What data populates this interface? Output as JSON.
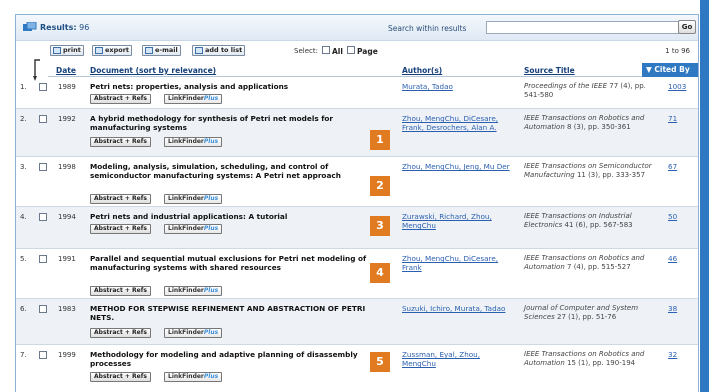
{
  "header": {
    "results_label": "Results:",
    "results_count": "96",
    "search_label": "Search within results",
    "search_value": "",
    "go_label": "Go"
  },
  "toolbar": {
    "print_label": "print",
    "export_label": "export",
    "email_label": "e-mail",
    "addlist_label": "add to list",
    "select_label": "Select:",
    "all_label": "All",
    "page_label": "Page",
    "range_text": "1 to 96"
  },
  "columns": {
    "date": "Date",
    "document": "Document (sort by relevance)",
    "author": "Author(s)",
    "source": "Source Title",
    "cited": "▼ Cited By"
  },
  "row_buttons": {
    "abstract": "Abstract + Refs",
    "linkfinder": "LinkFinder",
    "linkfinder_plus": "Plus"
  },
  "rows": [
    {
      "num": "1.",
      "year": "1989",
      "title": "Petri nets: properties, analysis and applications",
      "authors": "Murata, Tadao",
      "source_journal": "Proceedings of the IEEE",
      "source_detail": "77 (4), pp. 541-580",
      "cited": "1003"
    },
    {
      "num": "2.",
      "year": "1992",
      "title": "A hybrid methodology for synthesis of Petri net models for manufacturing systems",
      "authors": "Zhou, MengChu, DiCesare, Frank, Desrochers, Alan A.",
      "source_journal": "IEEE Transactions on Robotics and Automation",
      "source_detail": "8 (3), pp. 350-361",
      "cited": "71"
    },
    {
      "num": "3.",
      "year": "1998",
      "title": "Modeling, analysis, simulation, scheduling, and control of semiconductor manufacturing systems: A Petri net approach",
      "authors": "Zhou, MengChu, Jeng, Mu Der",
      "source_journal": "IEEE Transactions on Semiconductor Manufacturing",
      "source_detail": "11 (3), pp. 333-357",
      "cited": "67"
    },
    {
      "num": "4.",
      "year": "1994",
      "title": "Petri nets and industrial applications: A tutorial",
      "authors": "Zurawski, Richard, Zhou, MengChu",
      "source_journal": "IEEE Transactions on Industrial Electronics",
      "source_detail": "41 (6), pp. 567-583",
      "cited": "50"
    },
    {
      "num": "5.",
      "year": "1991",
      "title": "Parallel and sequential mutual exclusions for Petri net modeling of manufacturing systems with shared resources",
      "authors": "Zhou, MengChu, DiCesare, Frank",
      "source_journal": "IEEE Transactions on Robotics and Automation",
      "source_detail": "7 (4), pp. 515-527",
      "cited": "46"
    },
    {
      "num": "6.",
      "year": "1983",
      "title": "METHOD FOR STEPWISE REFINEMENT AND ABSTRACTION OF PETRI NETS.",
      "authors": "Suzuki, Ichiro, Murata, Tadao",
      "source_journal": "Journal of Computer and System Sciences",
      "source_detail": "27 (1), pp. 51-76",
      "cited": "38"
    },
    {
      "num": "7.",
      "year": "1999",
      "title": "Methodology for modeling and adaptive planning of disassembly processes",
      "authors": "Zussman, Eyal, Zhou, MengChu",
      "source_journal": "IEEE Transactions on Robotics and Automation",
      "source_detail": "15 (1), pp. 190-194",
      "cited": "32"
    }
  ],
  "badges": [
    "1",
    "2",
    "3",
    "4",
    "5"
  ],
  "colors": {
    "accent": "#2f79c2",
    "badge": "#e07b22",
    "link": "#2a5fb0"
  }
}
